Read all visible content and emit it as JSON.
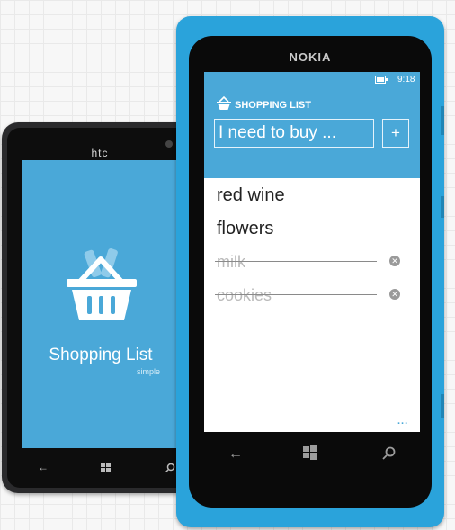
{
  "htc": {
    "brand": "htc",
    "splash_title": "Shopping List",
    "splash_subtitle": "simple"
  },
  "nokia": {
    "brand": "NOKIA",
    "status_time": "9:18",
    "app_title": "SHOPPING LIST",
    "input_placeholder": "I need to buy ...",
    "add_label": "+",
    "items": [
      {
        "label": "red wine",
        "done": false
      },
      {
        "label": "flowers",
        "done": false
      },
      {
        "label": "milk",
        "done": true
      },
      {
        "label": "cookies",
        "done": true
      }
    ],
    "more_label": "..."
  },
  "icons": [
    "basket-icon",
    "back-icon",
    "windows-start-icon",
    "search-icon",
    "delete-icon",
    "battery-icon"
  ],
  "colors": {
    "accent": "#4aa8d8",
    "nokia_body": "#2aa3db",
    "htc_body": "#2a2a2c"
  }
}
